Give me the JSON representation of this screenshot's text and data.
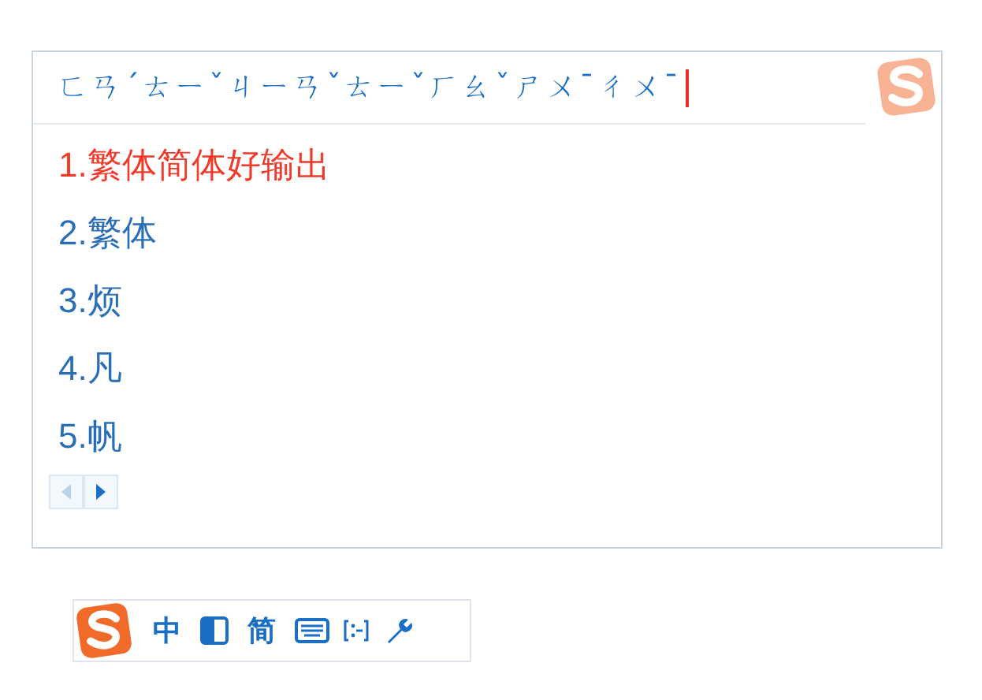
{
  "composition": "ㄈㄢˊㄊㄧˇㄐㄧㄢˇㄊㄧˇㄏㄠˇㄕㄨˉㄔㄨˉ",
  "candidates": [
    {
      "text": "1.繁体简体好输出",
      "selected": true
    },
    {
      "text": "2.繁体",
      "selected": false
    },
    {
      "text": "3.烦",
      "selected": false
    },
    {
      "text": "4.凡",
      "selected": false
    },
    {
      "text": "5.帆",
      "selected": false
    }
  ],
  "pager": {
    "previous": {
      "disabled": true
    },
    "next": {
      "disabled": false
    }
  },
  "toolbar": [
    {
      "kind": "logo"
    },
    {
      "kind": "text",
      "text": "中"
    },
    {
      "kind": "halfwidth"
    },
    {
      "kind": "text",
      "text": "简"
    },
    {
      "kind": "keyboard"
    },
    {
      "kind": "punctuation"
    },
    {
      "kind": "wrench"
    }
  ]
}
